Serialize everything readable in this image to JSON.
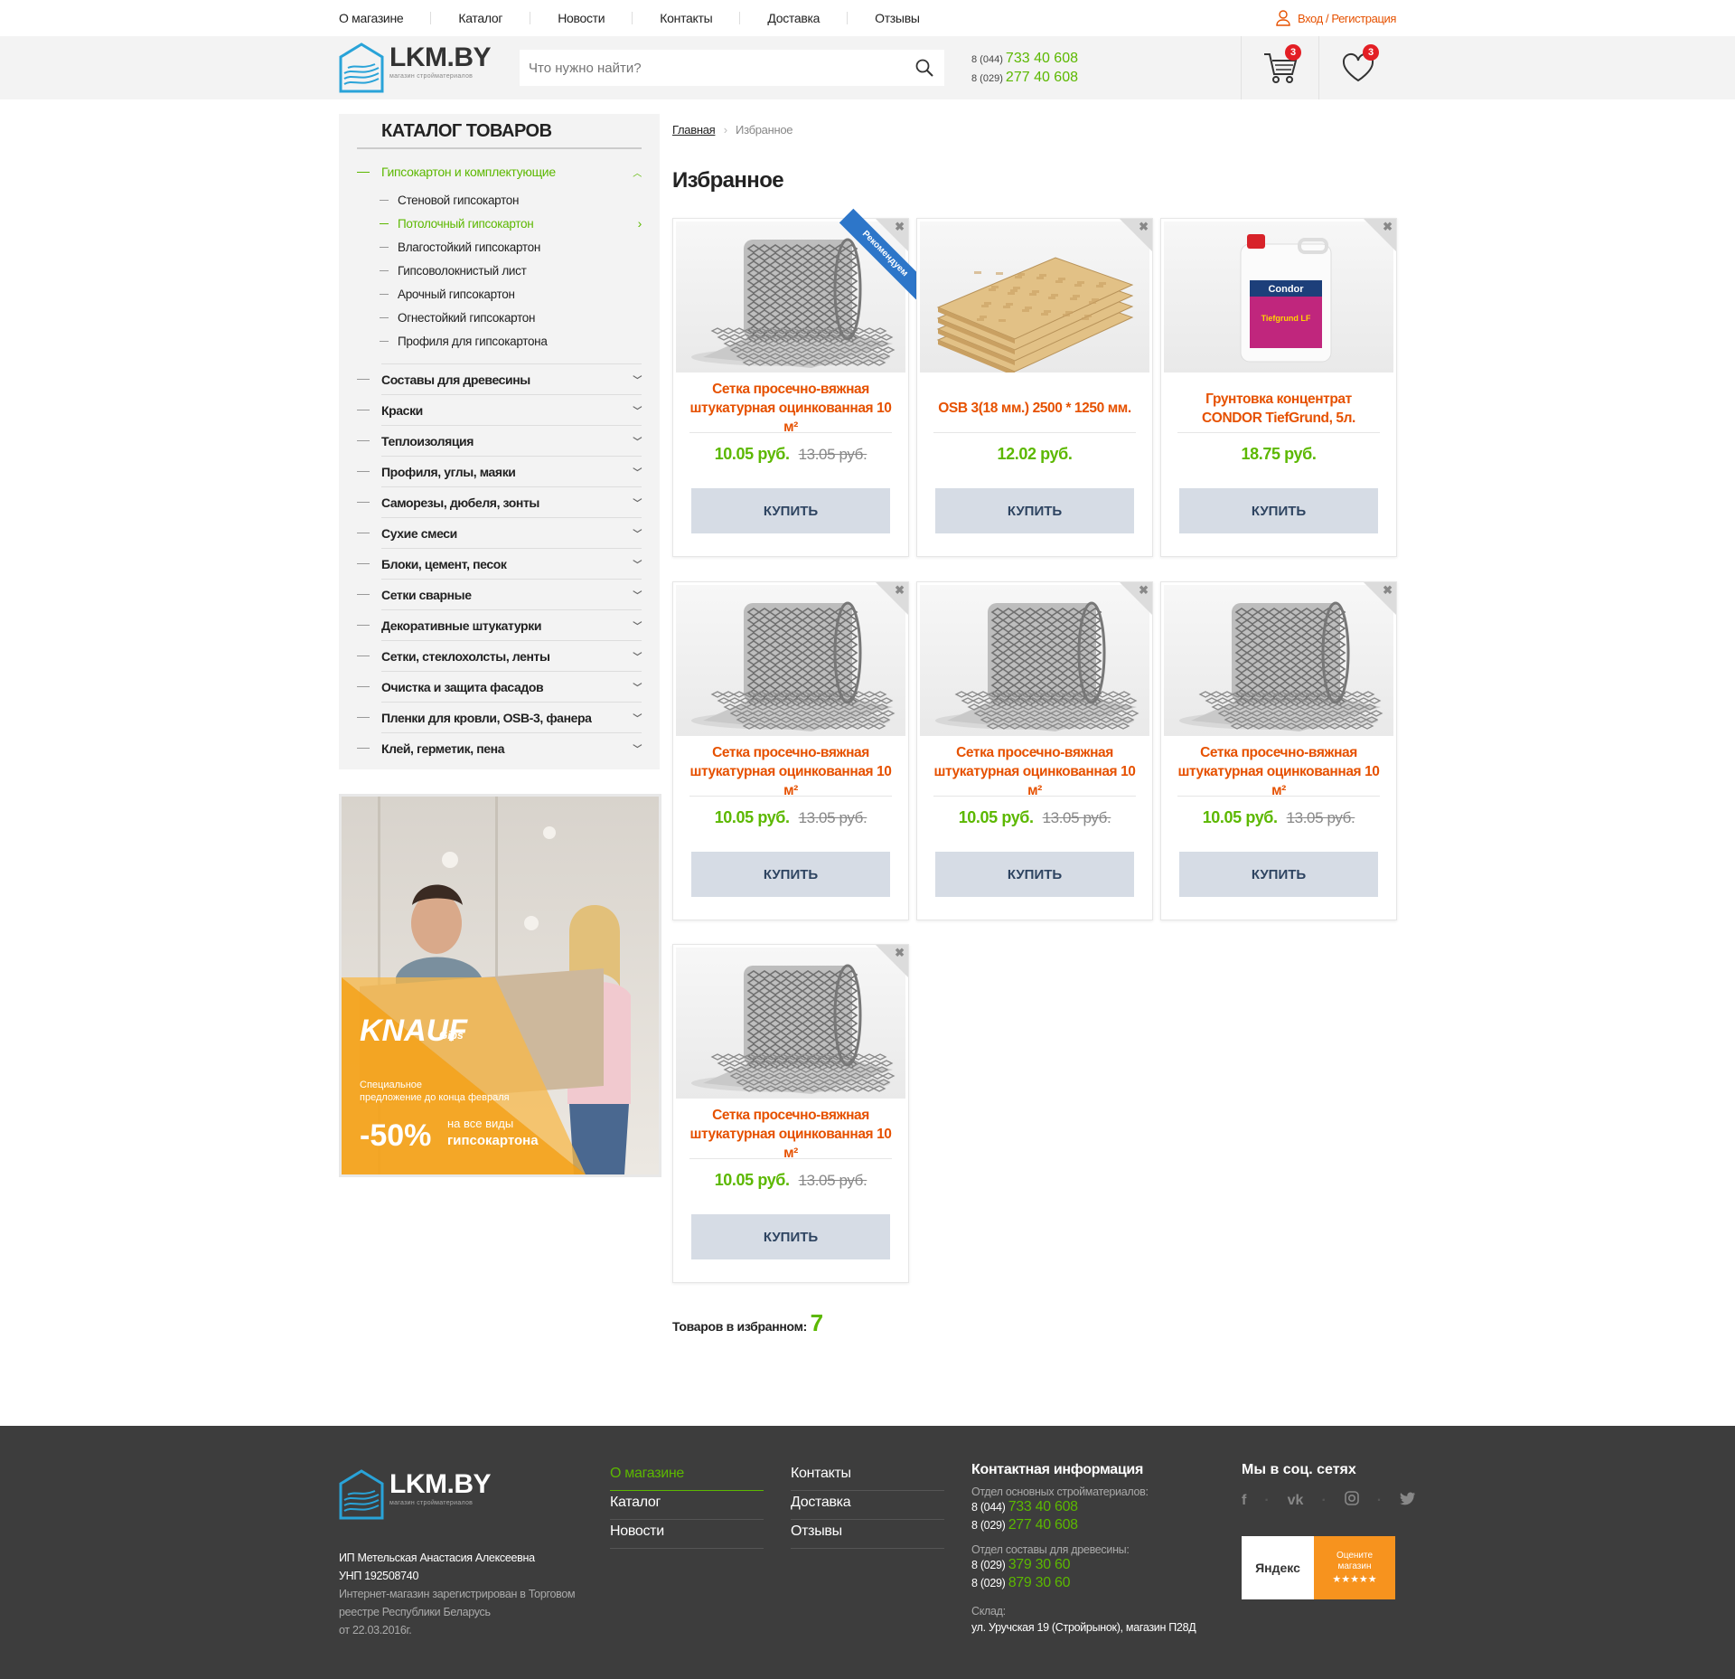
{
  "topnav": [
    "О магазине",
    "Каталог",
    "Новости",
    "Контакты",
    "Доставка",
    "Отзывы"
  ],
  "login_label": "Вход / Регистрация",
  "logo": {
    "name": "LKM.BY",
    "subtitle": "магазин стройматериалов"
  },
  "search": {
    "placeholder": "Что нужно найти?"
  },
  "phones": [
    {
      "code": "8 (044)",
      "number": "733 40 608"
    },
    {
      "code": "8 (029)",
      "number": "277 40 608"
    }
  ],
  "cart_count": "3",
  "favorites_count": "3",
  "catalog": {
    "title": "Каталог товаров",
    "active_category": "Гипсокартон и комплектующие",
    "subcategories": [
      "Стеновой гипсокартон",
      "Потолочный гипсокартон",
      "Влагостойкий гипсокартон",
      "Гипсоволокнистый лист",
      "Арочный гипсокартон",
      "Огнестойкий гипсокартон",
      "Профиля для гипсокартона"
    ],
    "active_subcategory_index": 1,
    "categories": [
      "Составы для древесины",
      "Краски",
      "Теплоизоляция",
      "Профиля, углы, маяки",
      "Саморезы, дюбеля, зонты",
      "Сухие смеси",
      "Блоки, цемент, песок",
      "Сетки сварные",
      "Декоративные штукатурки",
      "Сетки, стеклохолсты, ленты",
      "Очистка и защита фасадов",
      "Пленки для кровли, OSB-3, фанера",
      "Клей, герметик, пена"
    ]
  },
  "banner": {
    "brand": "KNAUF",
    "brand_sub": "Gips",
    "line1": "Специальное",
    "line2": "предложение до конца февраля",
    "discount": "-50%",
    "text1": "на все виды",
    "text2": "гипсокартона"
  },
  "breadcrumb": {
    "home": "Главная",
    "current": "Избранное"
  },
  "page_title": "Избранное",
  "ribbon_label": "Рекомендуем",
  "buy_label": "КУПИТЬ",
  "products": [
    {
      "name": "Сетка просечно-вяжная штукатурная оцинкованная 10 м²",
      "price": "10.05 руб.",
      "old_price": "13.05 руб.",
      "image": "mesh-roll",
      "recommended": true
    },
    {
      "name": "OSB 3(18 мм.) 2500 * 1250 мм.",
      "price": "12.02 руб.",
      "old_price": "",
      "image": "osb-boards",
      "recommended": false
    },
    {
      "name": "Грунтовка концентрат CONDOR TiefGrund, 5л.",
      "price": "18.75 руб.",
      "old_price": "",
      "image": "primer-canister",
      "recommended": false
    },
    {
      "name": "Сетка просечно-вяжная штукатурная оцинкованная 10 м²",
      "price": "10.05 руб.",
      "old_price": "13.05 руб.",
      "image": "mesh-roll",
      "recommended": false
    },
    {
      "name": "Сетка просечно-вяжная штукатурная оцинкованная 10 м²",
      "price": "10.05 руб.",
      "old_price": "13.05 руб.",
      "image": "mesh-roll",
      "recommended": false
    },
    {
      "name": "Сетка просечно-вяжная штукатурная оцинкованная 10 м²",
      "price": "10.05 руб.",
      "old_price": "13.05 руб.",
      "image": "mesh-roll",
      "recommended": false
    },
    {
      "name": "Сетка просечно-вяжная штукатурная оцинкованная 10 м²",
      "price": "10.05 руб.",
      "old_price": "13.05 руб.",
      "image": "mesh-roll",
      "recommended": false
    }
  ],
  "primer_labels": {
    "brand": "Condor",
    "product": "Tiefgrund LF"
  },
  "favorites_count_label": "Товаров в избранном:",
  "favorites_total": "7",
  "footer": {
    "col1": [
      "О магазине",
      "Каталог",
      "Новости"
    ],
    "col2": [
      "Контакты",
      "Доставка",
      "Отзывы"
    ],
    "company_name": "ИП Метельская Анастасия Алексеевна",
    "unp": "УНП 192508740",
    "registry": "Интернет-магазин зарегистрирован в Торговом реестре Республики Беларусь",
    "registry_date": "от 22.03.2016г.",
    "contacts_title": "Контактная информация",
    "dept1": "Отдел основных стройматериалов:",
    "dept1_phones": [
      {
        "code": "8 (044)",
        "number": "733 40 608"
      },
      {
        "code": "8 (029)",
        "number": "277 40 608"
      }
    ],
    "dept2": "Отдел составы для древесины:",
    "dept2_phones": [
      {
        "code": "8 (029)",
        "number": "379 30 60"
      },
      {
        "code": "8 (029)",
        "number": "879 30 60"
      }
    ],
    "warehouse_label": "Склад:",
    "warehouse_address": "ул. Уручская 19 (Стройрынок), магазин П28Д",
    "social_title": "Мы в соц. сетях",
    "social_icons": [
      "facebook-icon",
      "vk-icon",
      "instagram-icon",
      "twitter-icon"
    ],
    "yandex_brand": "Яндекс",
    "yandex_text1": "Оцените",
    "yandex_text2": "магазин",
    "yandex_stars": "★★★★★"
  },
  "colors": {
    "accent_green": "#5cb800",
    "accent_orange": "#e65100",
    "footer_bg": "#3d3d3d",
    "button_bg": "#d6dce5",
    "badge_red": "#e31e24"
  }
}
